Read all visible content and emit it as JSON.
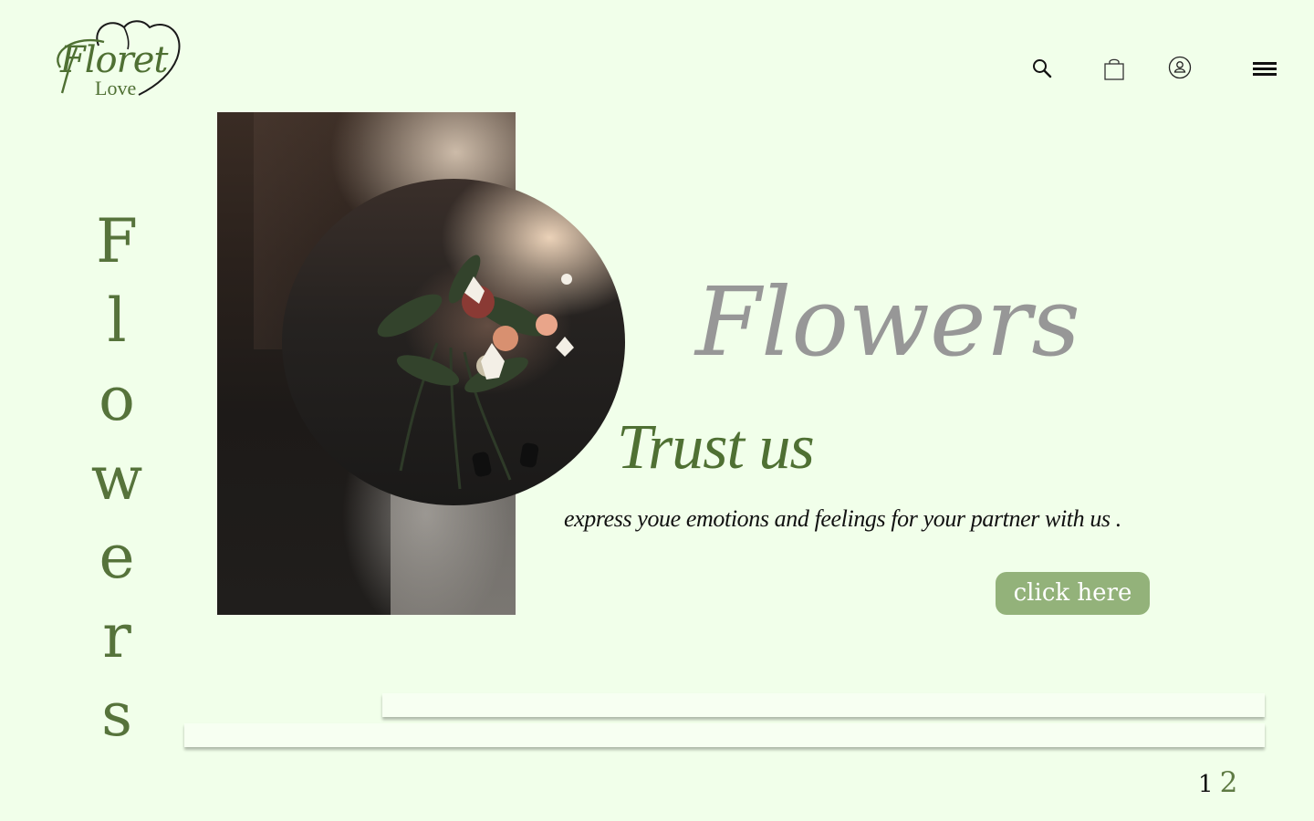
{
  "brand": {
    "logo_script": "Floret",
    "logo_sub": "Love",
    "color": "#4f7033"
  },
  "header": {
    "icons": [
      {
        "name": "search-icon"
      },
      {
        "name": "bag-icon"
      },
      {
        "name": "user-icon"
      },
      {
        "name": "menu-icon"
      }
    ]
  },
  "sidebar": {
    "vertical_word_letters": [
      "F",
      "l",
      "o",
      "w",
      "e",
      "r",
      "s"
    ]
  },
  "hero": {
    "title": "Flowers",
    "subtitle": "Trust us",
    "tagline": "express youe emotions and feelings for your partner with us .",
    "cta_label": "click here"
  },
  "pagination": {
    "pages": [
      "1",
      "2"
    ]
  },
  "colors": {
    "background": "#f1ffea",
    "accent_green": "#56733b",
    "button_green": "#93b27a",
    "title_gray": "#979797"
  }
}
